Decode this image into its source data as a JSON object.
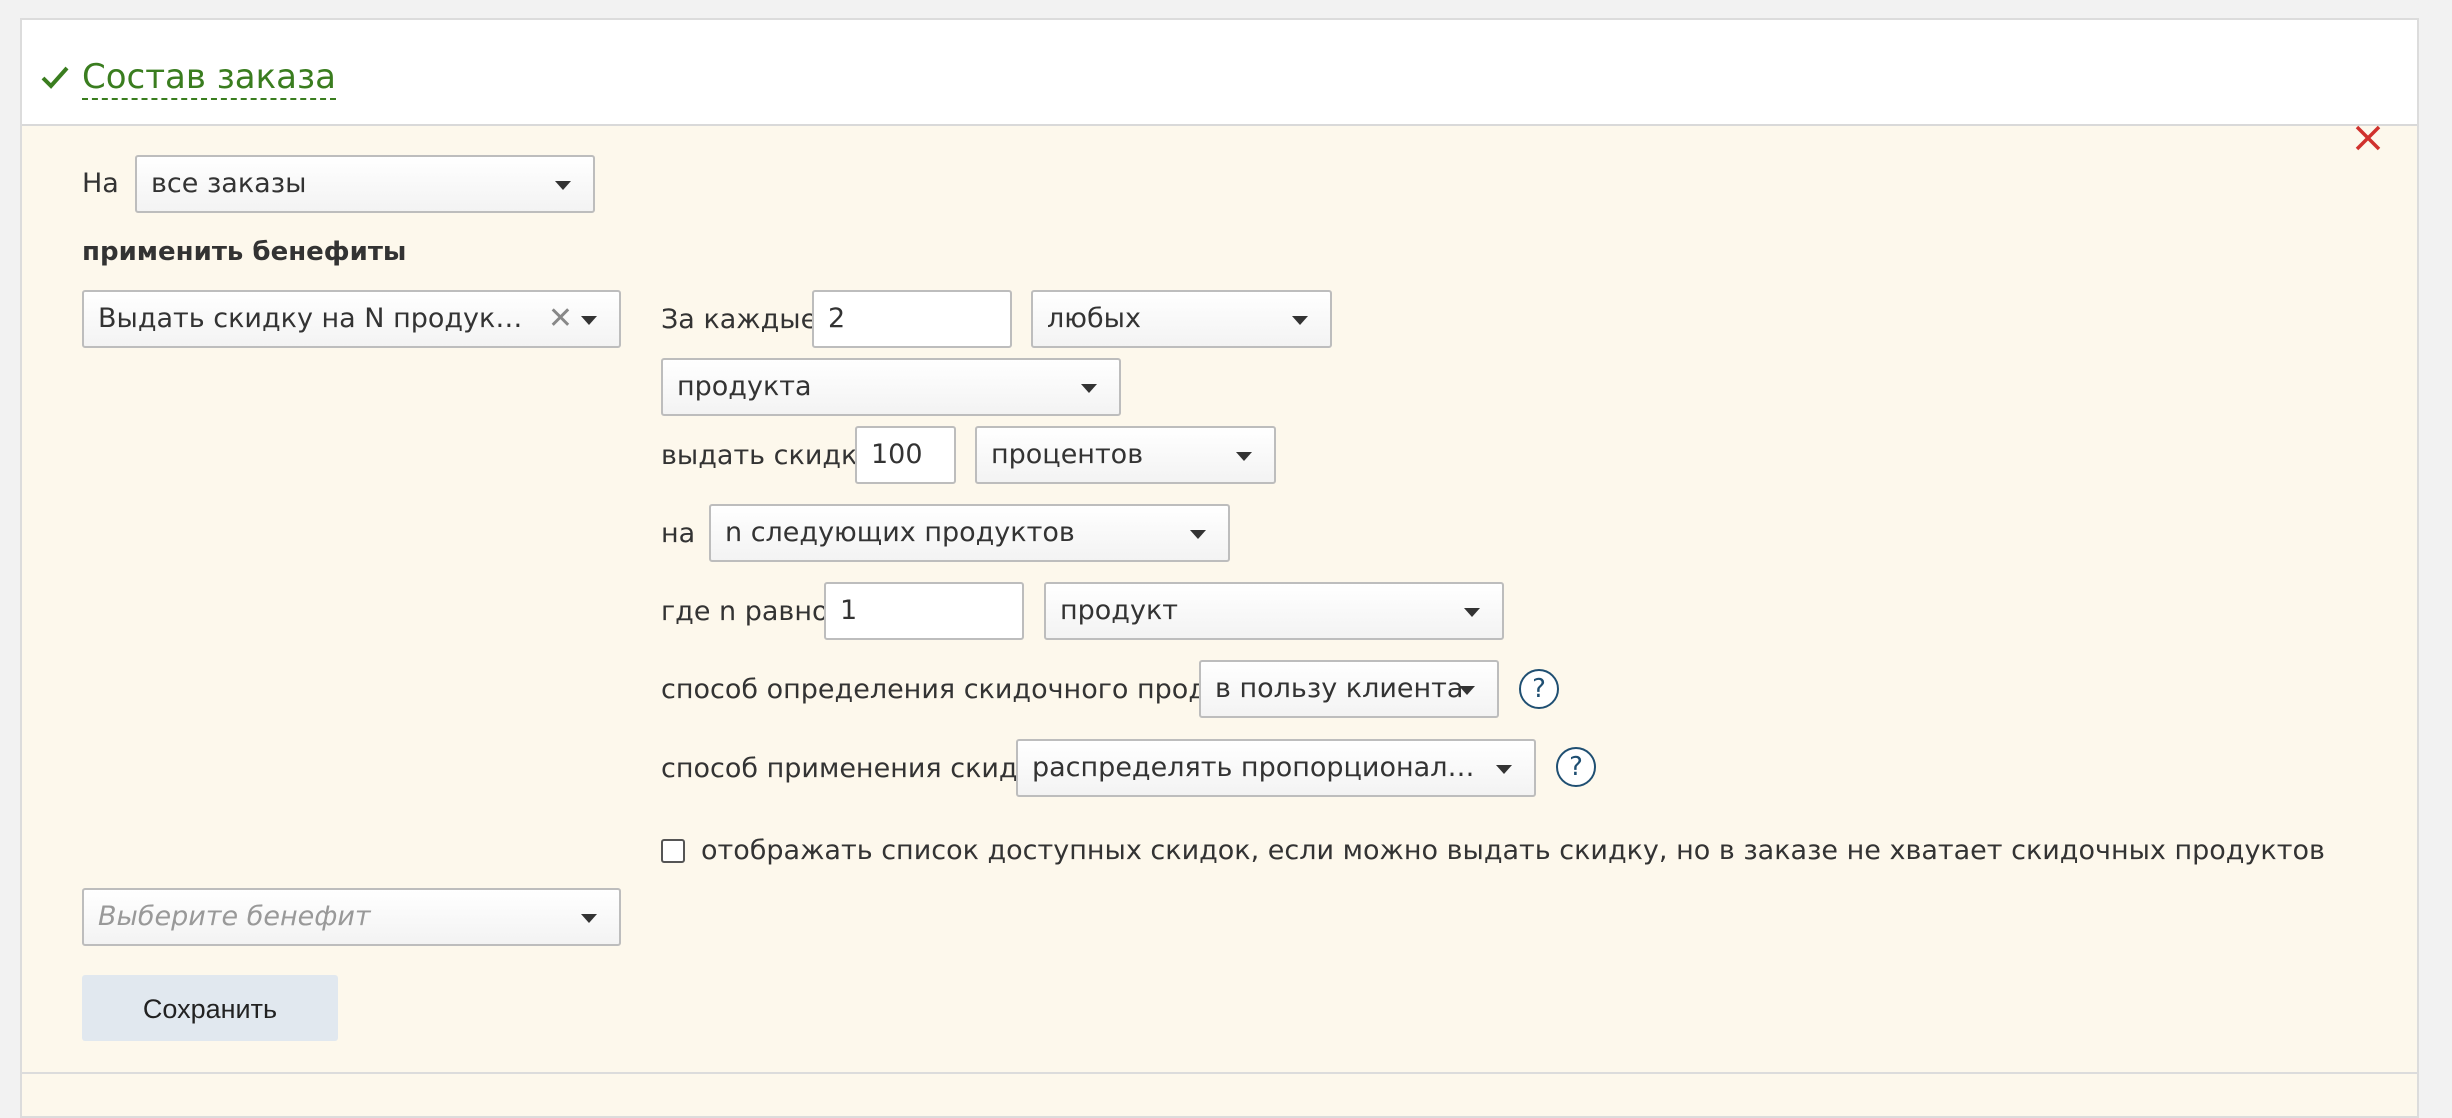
{
  "header": {
    "title": "Состав заказа",
    "status_icon": "check-icon",
    "accent_color": "#3a7d1f"
  },
  "close_icon": "close-icon",
  "scope": {
    "label": "На",
    "value": "все заказы"
  },
  "benefits": {
    "heading": "применить бенефиты",
    "selected_benefit": "Выдать скидку на N продуктов при …",
    "add_benefit_placeholder": "Выберите бенефит"
  },
  "rule": {
    "every_label": "За каждые",
    "every_count": "2",
    "any_select": "любых",
    "product_select": "продукта",
    "discount_label": "выдать скидку",
    "discount_value": "100",
    "discount_unit": "процентов",
    "on_label": "на",
    "on_select": "n следующих продуктов",
    "n_label": "где n равно",
    "n_value": "1",
    "n_unit": "продукт",
    "method_label": "способ определения скидочного продукта",
    "method_select": "в пользу клиента",
    "apply_label": "способ применения скидки",
    "apply_select": "распределять пропорционально ст…",
    "help_glyph": "?",
    "checkbox_label": "отображать список доступных скидок, если можно выдать скидку, но в заказе не хватает скидочных продуктов",
    "checkbox_checked": false
  },
  "save_button": "Сохранить",
  "colors": {
    "body_bg": "#fdf8ec",
    "close": "#d0312d",
    "help": "#1f4f72"
  }
}
